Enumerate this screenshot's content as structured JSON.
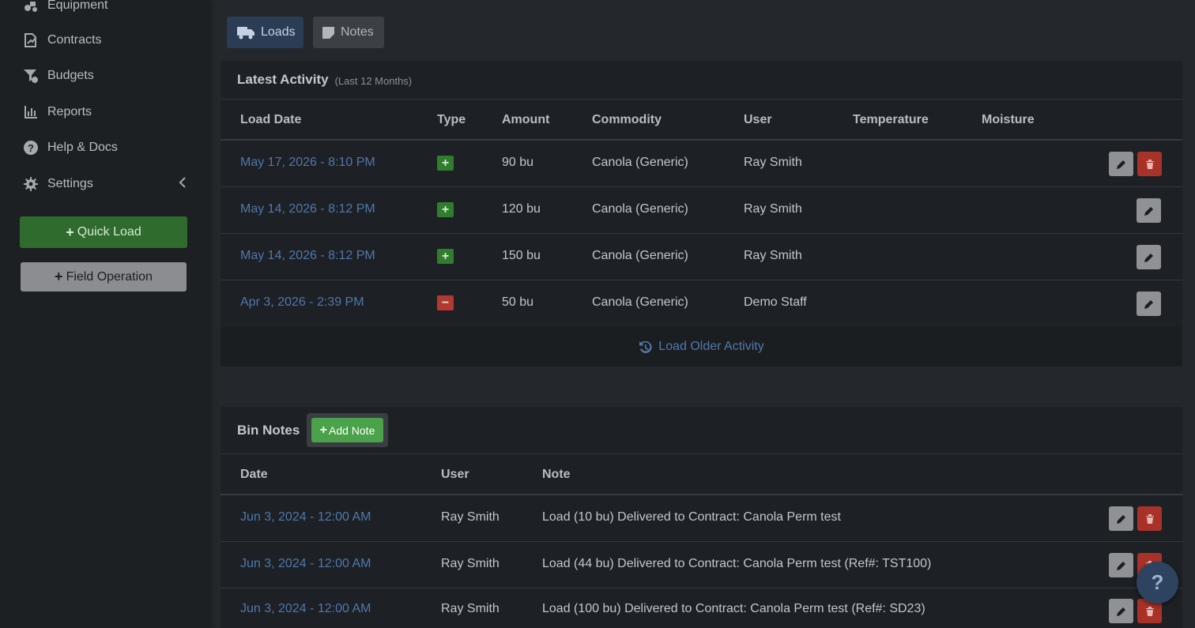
{
  "sidebar": {
    "items": [
      {
        "label": "Equipment",
        "icon": "tractor-icon"
      },
      {
        "label": "Contracts",
        "icon": "contract-icon"
      },
      {
        "label": "Budgets",
        "icon": "budget-icon"
      },
      {
        "label": "Reports",
        "icon": "chart-icon"
      },
      {
        "label": "Help & Docs",
        "icon": "question-circle-icon"
      },
      {
        "label": "Settings",
        "icon": "gear-icon"
      }
    ],
    "quick_load_label": "Quick Load",
    "field_operation_label": "Field Operation"
  },
  "tabs": {
    "loads": "Loads",
    "notes": "Notes"
  },
  "activity": {
    "title": "Latest Activity",
    "subtitle": "(Last 12 Months)",
    "columns": [
      "Load Date",
      "Type",
      "Amount",
      "Commodity",
      "User",
      "Temperature",
      "Moisture"
    ],
    "rows": [
      {
        "date": "May 17, 2026 - 8:10 PM",
        "type": "in",
        "amount": "90 bu",
        "commodity": "Canola (Generic)",
        "user": "Ray Smith",
        "temperature": "",
        "moisture": ""
      },
      {
        "date": "May 14, 2026 - 8:12 PM",
        "type": "in",
        "amount": "120 bu",
        "commodity": "Canola (Generic)",
        "user": "Ray Smith",
        "temperature": "",
        "moisture": ""
      },
      {
        "date": "May 14, 2026 - 8:12 PM",
        "type": "in",
        "amount": "150 bu",
        "commodity": "Canola (Generic)",
        "user": "Ray Smith",
        "temperature": "",
        "moisture": ""
      },
      {
        "date": "Apr 3, 2026 - 2:39 PM",
        "type": "out",
        "amount": "50 bu",
        "commodity": "Canola (Generic)",
        "user": "Demo Staff",
        "temperature": "",
        "moisture": ""
      }
    ],
    "load_older_label": "Load Older Activity"
  },
  "notes": {
    "title": "Bin Notes",
    "add_note_label": "Add Note",
    "columns": [
      "Date",
      "User",
      "Note"
    ],
    "rows": [
      {
        "date": "Jun 3, 2024 - 12:00 AM",
        "user": "Ray Smith",
        "note": "Load (10 bu) Delivered to Contract: Canola Perm test"
      },
      {
        "date": "Jun 3, 2024 - 12:00 AM",
        "user": "Ray Smith",
        "note": "Load (44 bu) Delivered to Contract: Canola Perm test (Ref#: TST100)"
      },
      {
        "date": "Jun 3, 2024 - 12:00 AM",
        "user": "Ray Smith",
        "note": "Load (100 bu) Delivered to Contract: Canola Perm test (Ref#: SD23)"
      }
    ]
  },
  "help_fab_label": "?",
  "colors": {
    "link": "#4f78ad",
    "success": "#2f7d2d",
    "danger": "#a93228",
    "add_note": "#4aa24a"
  }
}
